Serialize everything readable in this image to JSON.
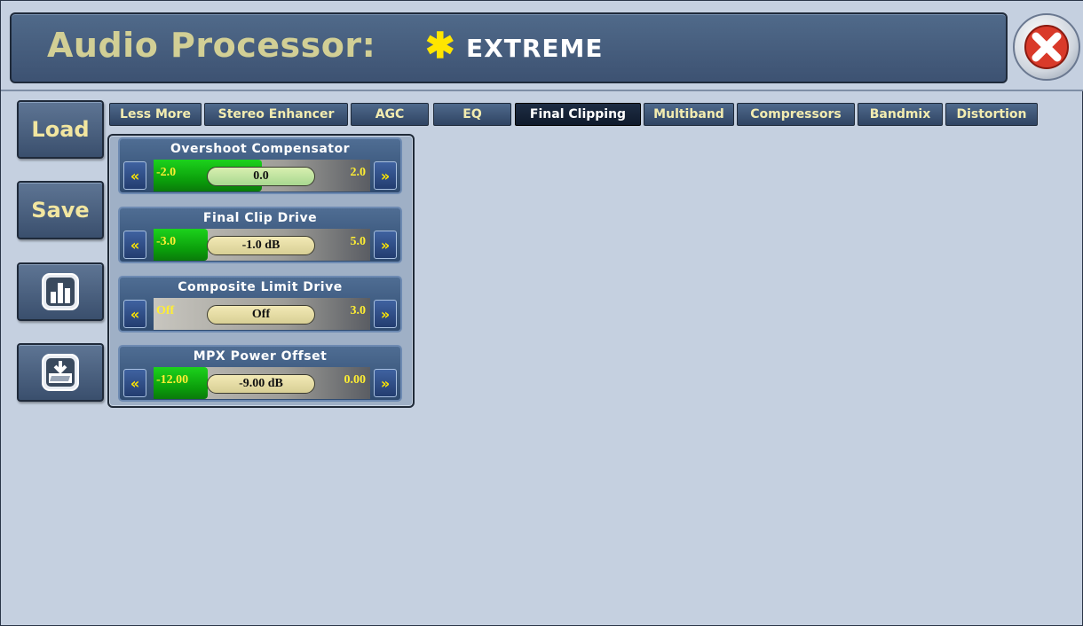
{
  "header": {
    "title": "Audio Processor:",
    "preset_star": "✱",
    "preset_name": "EXTREME",
    "close_icon": "close-icon"
  },
  "sidebar": {
    "load_label": "Load",
    "save_label": "Save",
    "meter_icon": "bar-chart-icon",
    "import_icon": "folder-download-icon"
  },
  "tabs": [
    {
      "label": "Less More",
      "active": false
    },
    {
      "label": "Stereo Enhancer",
      "active": false
    },
    {
      "label": "AGC",
      "active": false
    },
    {
      "label": "EQ",
      "active": false
    },
    {
      "label": "Final Clipping",
      "active": true
    },
    {
      "label": "Multiband",
      "active": false
    },
    {
      "label": "Compressors",
      "active": false
    },
    {
      "label": "Bandmix",
      "active": false
    },
    {
      "label": "Distortion",
      "active": false
    }
  ],
  "controls": [
    {
      "title": "Overshoot Compensator",
      "min": "-2.0",
      "max": "2.0",
      "value": "0.0",
      "fraction": 0.5,
      "left": "«",
      "right": "»"
    },
    {
      "title": "Final Clip Drive",
      "min": "-3.0",
      "max": "5.0",
      "value": "-1.0 dB",
      "fraction": 0.25,
      "left": "«",
      "right": "»"
    },
    {
      "title": "Composite Limit Drive",
      "min": "Off",
      "max": "3.0",
      "value": "Off",
      "fraction": 0.0,
      "left": "«",
      "right": "»"
    },
    {
      "title": "MPX Power Offset",
      "min": "-12.00",
      "max": "0.00",
      "value": "-9.00 dB",
      "fraction": 0.25,
      "left": "«",
      "right": "»"
    }
  ],
  "colors": {
    "title_text": "#d2cf95",
    "preset_star": "#ffe500",
    "tab_text": "#f3ecb0",
    "fill_green": "#0a9a0a",
    "arrow_yellow": "#ffe600"
  }
}
